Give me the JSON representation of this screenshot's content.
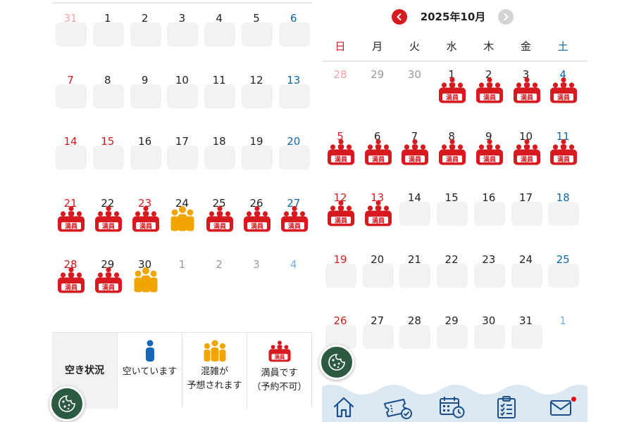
{
  "colors": {
    "red": "#d71920",
    "blue": "#0d66a6",
    "yellow": "#f0a500",
    "person_blue": "#1565b8",
    "fab_green": "#2b5a41",
    "nav_bg": "#dce8f1",
    "nav_icon": "#1a4f8b"
  },
  "full_icon_label": "満員",
  "left_calendar": {
    "days": [
      {
        "day": "31",
        "tone": "pink",
        "status": "slot"
      },
      {
        "day": "1",
        "tone": "black",
        "status": "slot"
      },
      {
        "day": "2",
        "tone": "black",
        "status": "slot"
      },
      {
        "day": "3",
        "tone": "black",
        "status": "slot"
      },
      {
        "day": "4",
        "tone": "black",
        "status": "slot"
      },
      {
        "day": "5",
        "tone": "black",
        "status": "slot"
      },
      {
        "day": "6",
        "tone": "blue",
        "status": "slot"
      },
      {
        "day": "7",
        "tone": "red",
        "status": "slot"
      },
      {
        "day": "8",
        "tone": "black",
        "status": "slot"
      },
      {
        "day": "9",
        "tone": "black",
        "status": "slot"
      },
      {
        "day": "10",
        "tone": "black",
        "status": "slot"
      },
      {
        "day": "11",
        "tone": "black",
        "status": "slot"
      },
      {
        "day": "12",
        "tone": "black",
        "status": "slot"
      },
      {
        "day": "13",
        "tone": "blue",
        "status": "slot"
      },
      {
        "day": "14",
        "tone": "red",
        "status": "slot"
      },
      {
        "day": "15",
        "tone": "red",
        "status": "slot"
      },
      {
        "day": "16",
        "tone": "black",
        "status": "slot"
      },
      {
        "day": "17",
        "tone": "black",
        "status": "slot"
      },
      {
        "day": "18",
        "tone": "black",
        "status": "slot"
      },
      {
        "day": "19",
        "tone": "black",
        "status": "slot"
      },
      {
        "day": "20",
        "tone": "blue",
        "status": "slot"
      },
      {
        "day": "21",
        "tone": "red",
        "status": "full"
      },
      {
        "day": "22",
        "tone": "black",
        "status": "full"
      },
      {
        "day": "23",
        "tone": "red",
        "status": "full"
      },
      {
        "day": "24",
        "tone": "black",
        "status": "crowded"
      },
      {
        "day": "25",
        "tone": "black",
        "status": "full"
      },
      {
        "day": "26",
        "tone": "black",
        "status": "full"
      },
      {
        "day": "27",
        "tone": "blue",
        "status": "full"
      },
      {
        "day": "28",
        "tone": "red",
        "status": "full"
      },
      {
        "day": "29",
        "tone": "black",
        "status": "full"
      },
      {
        "day": "30",
        "tone": "black",
        "status": "crowded"
      },
      {
        "day": "1",
        "tone": "gray",
        "status": "none"
      },
      {
        "day": "2",
        "tone": "gray",
        "status": "none"
      },
      {
        "day": "3",
        "tone": "gray",
        "status": "none"
      },
      {
        "day": "4",
        "tone": "lblue",
        "status": "none"
      }
    ]
  },
  "legend": {
    "title": "空き状況",
    "available": "空いています",
    "crowded_line1": "混雑が",
    "crowded_line2": "予想されます",
    "full_line1": "満員です",
    "full_line2": "（予約不可）"
  },
  "right_calendar": {
    "month_title": "2025年10月",
    "weekdays": [
      {
        "label": "日",
        "tone": "red"
      },
      {
        "label": "月",
        "tone": "black"
      },
      {
        "label": "火",
        "tone": "black"
      },
      {
        "label": "水",
        "tone": "black"
      },
      {
        "label": "木",
        "tone": "black"
      },
      {
        "label": "金",
        "tone": "black"
      },
      {
        "label": "土",
        "tone": "blue"
      }
    ],
    "days": [
      {
        "day": "28",
        "tone": "pink",
        "status": "none"
      },
      {
        "day": "29",
        "tone": "gray",
        "status": "none"
      },
      {
        "day": "30",
        "tone": "gray",
        "status": "none"
      },
      {
        "day": "1",
        "tone": "black",
        "status": "full"
      },
      {
        "day": "2",
        "tone": "black",
        "status": "full"
      },
      {
        "day": "3",
        "tone": "black",
        "status": "full"
      },
      {
        "day": "4",
        "tone": "blue",
        "status": "full"
      },
      {
        "day": "5",
        "tone": "red",
        "status": "full"
      },
      {
        "day": "6",
        "tone": "black",
        "status": "full"
      },
      {
        "day": "7",
        "tone": "black",
        "status": "full"
      },
      {
        "day": "8",
        "tone": "black",
        "status": "full"
      },
      {
        "day": "9",
        "tone": "black",
        "status": "full"
      },
      {
        "day": "10",
        "tone": "black",
        "status": "full"
      },
      {
        "day": "11",
        "tone": "blue",
        "status": "full"
      },
      {
        "day": "12",
        "tone": "red",
        "status": "full"
      },
      {
        "day": "13",
        "tone": "red",
        "status": "full"
      },
      {
        "day": "14",
        "tone": "black",
        "status": "slot"
      },
      {
        "day": "15",
        "tone": "black",
        "status": "slot"
      },
      {
        "day": "16",
        "tone": "black",
        "status": "slot"
      },
      {
        "day": "17",
        "tone": "black",
        "status": "slot"
      },
      {
        "day": "18",
        "tone": "blue",
        "status": "slot"
      },
      {
        "day": "19",
        "tone": "red",
        "status": "slot"
      },
      {
        "day": "20",
        "tone": "black",
        "status": "slot"
      },
      {
        "day": "21",
        "tone": "black",
        "status": "slot"
      },
      {
        "day": "22",
        "tone": "black",
        "status": "slot"
      },
      {
        "day": "23",
        "tone": "black",
        "status": "slot"
      },
      {
        "day": "24",
        "tone": "black",
        "status": "slot"
      },
      {
        "day": "25",
        "tone": "blue",
        "status": "slot"
      },
      {
        "day": "26",
        "tone": "red",
        "status": "slot"
      },
      {
        "day": "27",
        "tone": "black",
        "status": "slot"
      },
      {
        "day": "28",
        "tone": "black",
        "status": "slot"
      },
      {
        "day": "29",
        "tone": "black",
        "status": "slot"
      },
      {
        "day": "30",
        "tone": "black",
        "status": "slot"
      },
      {
        "day": "31",
        "tone": "black",
        "status": "slot"
      },
      {
        "day": "1",
        "tone": "lblue",
        "status": "none"
      }
    ]
  },
  "bottom_nav": {
    "items": [
      "home-icon",
      "ticket-icon",
      "calendar-clock-icon",
      "checklist-icon",
      "mail-icon"
    ],
    "has_notification": true
  }
}
